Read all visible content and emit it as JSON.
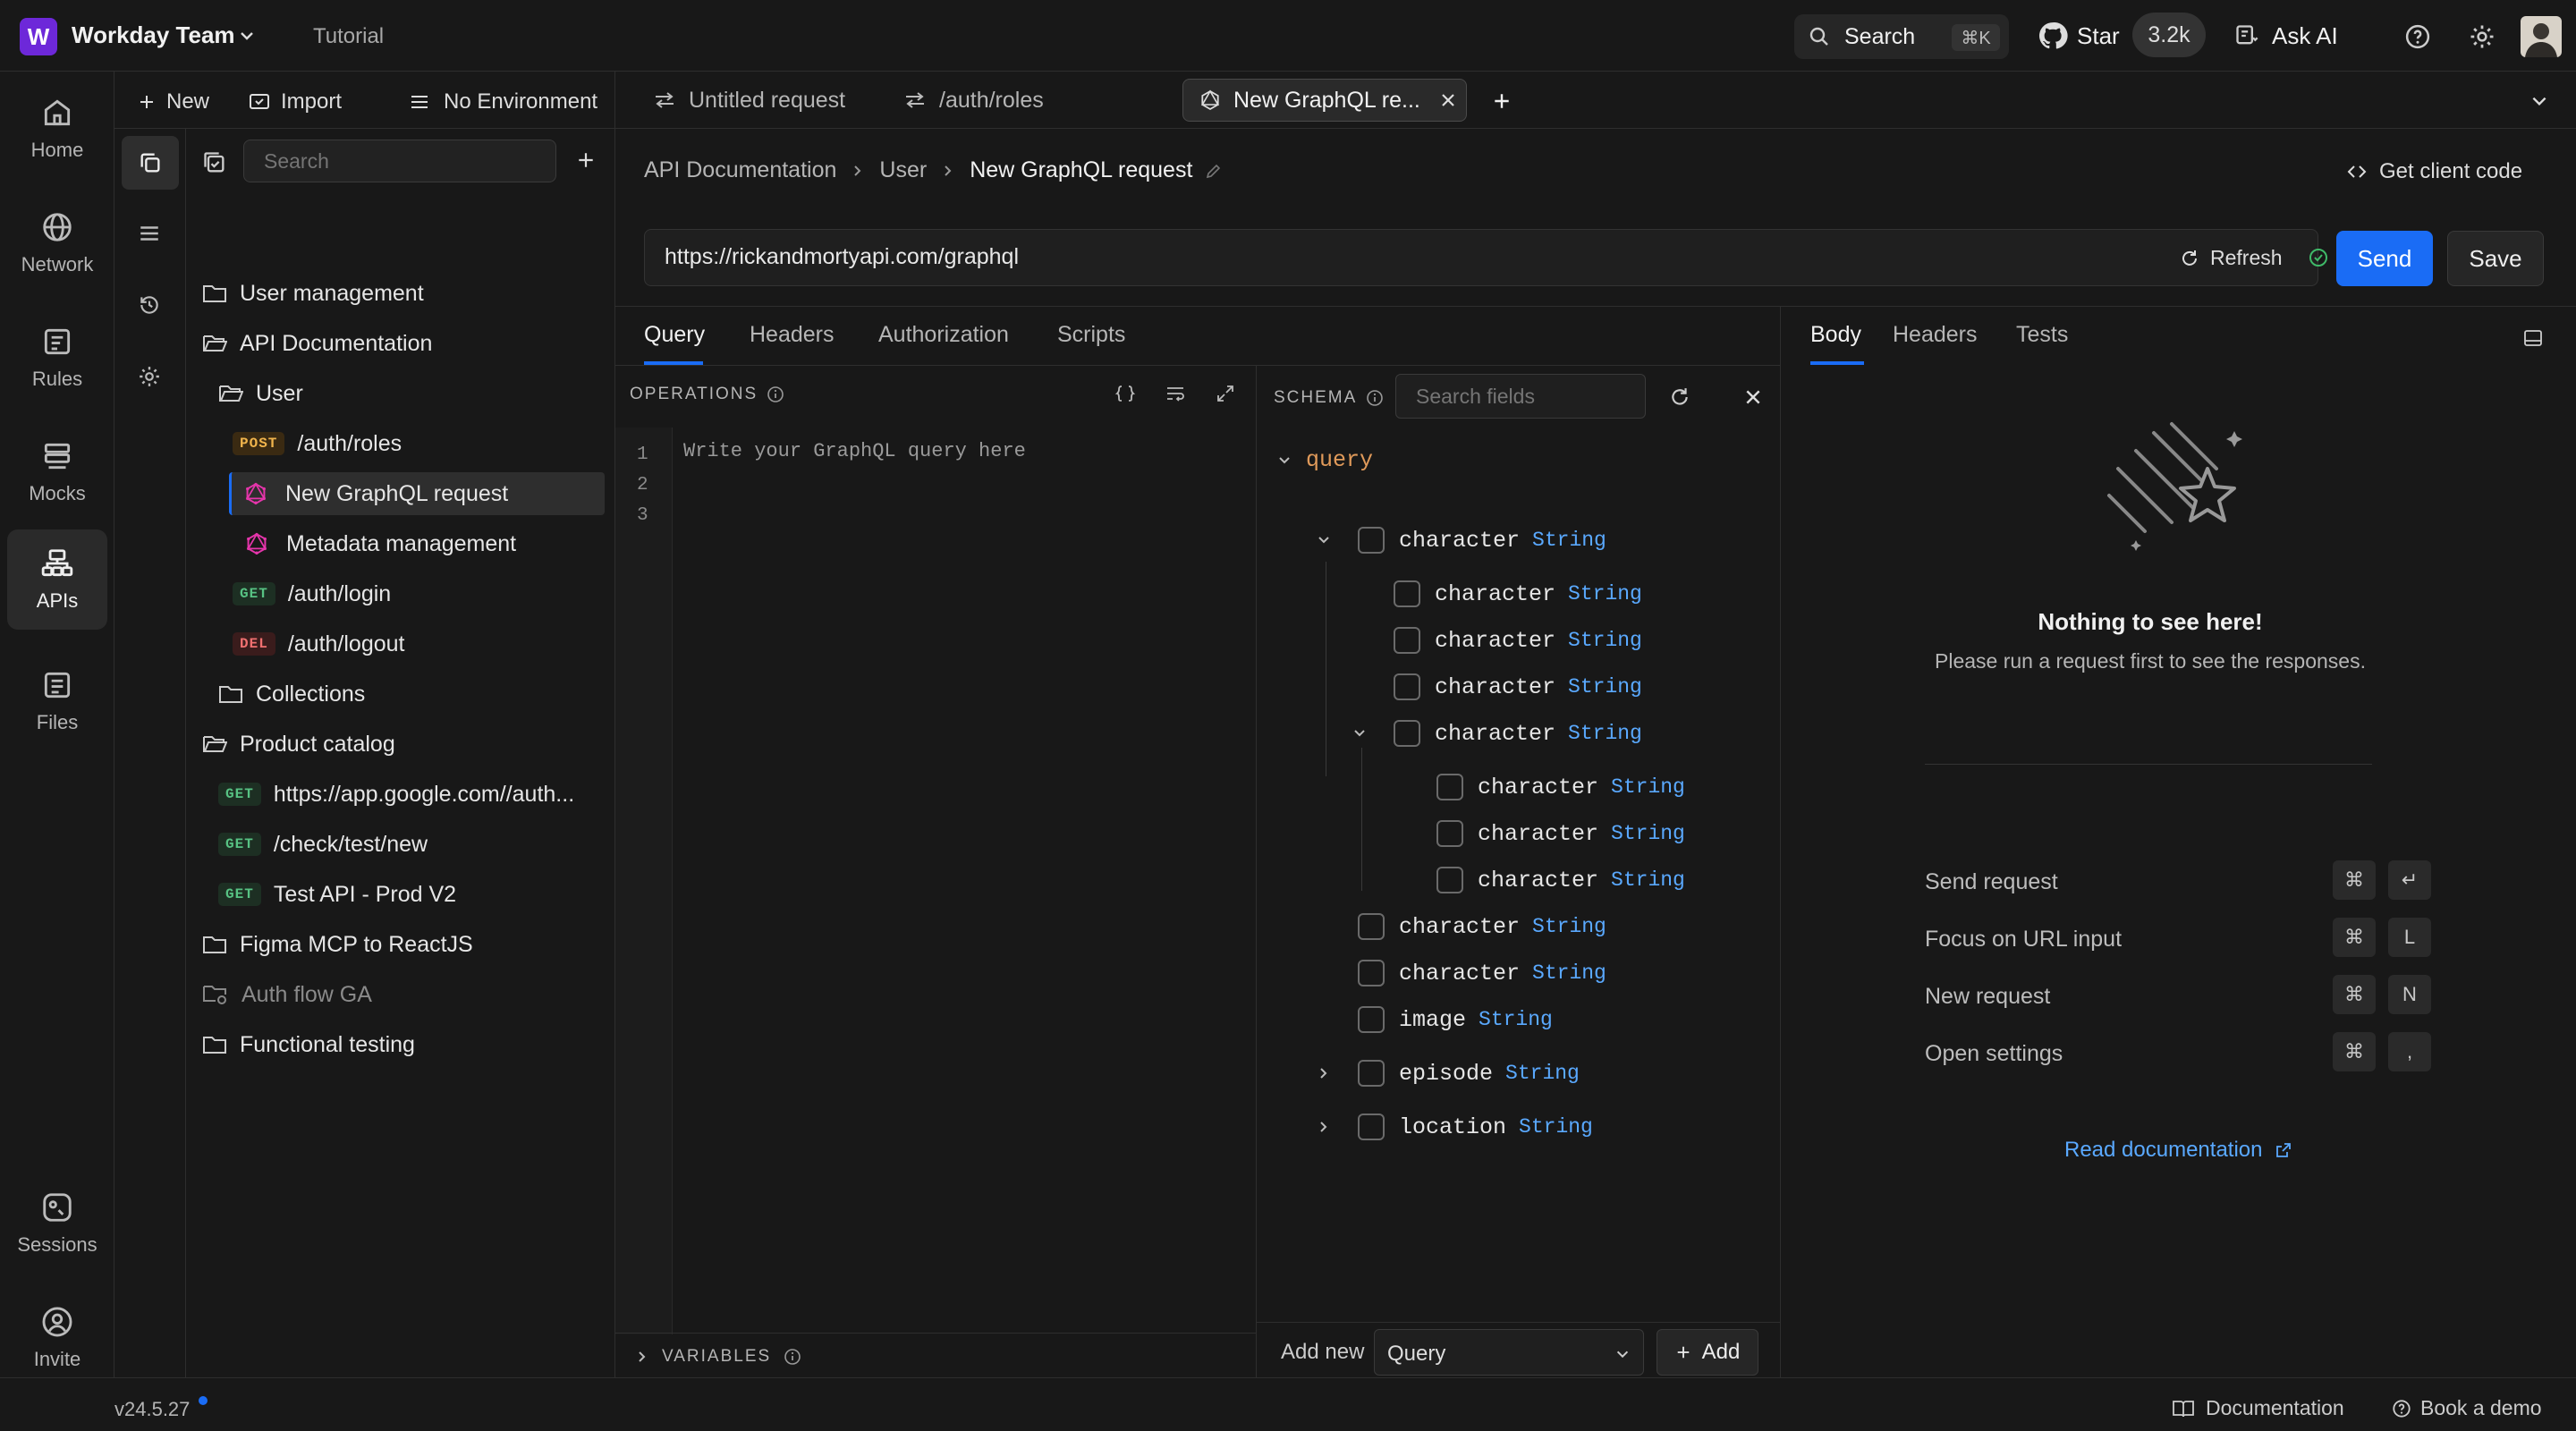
{
  "topbar": {
    "logo_letter": "W",
    "team": "Workday Team",
    "tutorial": "Tutorial",
    "search": "Search",
    "search_kbd": "⌘K",
    "star": "Star",
    "star_count": "3.2k",
    "ask_ai": "Ask AI"
  },
  "leftnav": {
    "items": [
      {
        "label": "Home",
        "icon": "home-icon"
      },
      {
        "label": "Network",
        "icon": "globe-icon"
      },
      {
        "label": "Rules",
        "icon": "rules-icon"
      },
      {
        "label": "Mocks",
        "icon": "mocks-icon"
      },
      {
        "label": "APIs",
        "icon": "apis-icon"
      },
      {
        "label": "Files",
        "icon": "files-icon"
      }
    ],
    "bottom": [
      {
        "label": "Sessions",
        "icon": "sessions-icon"
      },
      {
        "label": "Invite",
        "icon": "invite-icon"
      }
    ]
  },
  "sidebar": {
    "new": "New",
    "import": "Import",
    "environment": "No Environment",
    "search_placeholder": "Search",
    "tree": [
      {
        "label": "User management",
        "kind": "folder"
      },
      {
        "label": "API Documentation",
        "kind": "folder-open"
      },
      {
        "label": "User",
        "kind": "folder-open"
      },
      {
        "label": "/auth/roles",
        "kind": "request",
        "method": "POST"
      },
      {
        "label": "New GraphQL request",
        "kind": "graphql",
        "selected": true
      },
      {
        "label": "Metadata management",
        "kind": "graphql"
      },
      {
        "label": "/auth/login",
        "kind": "request",
        "method": "GET"
      },
      {
        "label": "/auth/logout",
        "kind": "request",
        "method": "DEL"
      },
      {
        "label": "Collections",
        "kind": "folder"
      },
      {
        "label": "Product catalog",
        "kind": "folder-open"
      },
      {
        "label": "https://app.google.com//auth...",
        "kind": "request",
        "method": "GET"
      },
      {
        "label": "/check/test/new",
        "kind": "request",
        "method": "GET"
      },
      {
        "label": "Test API - Prod V2",
        "kind": "request",
        "method": "GET"
      },
      {
        "label": "Figma MCP to ReactJS",
        "kind": "folder"
      },
      {
        "label": "Auth flow GA",
        "kind": "folder-dim"
      },
      {
        "label": "Functional testing",
        "kind": "folder"
      }
    ]
  },
  "tabs": [
    {
      "label": "Untitled request"
    },
    {
      "label": "/auth/roles"
    },
    {
      "label": "New GraphQL re...",
      "active": true
    }
  ],
  "breadcrumb": {
    "root": "API Documentation",
    "mid": "User",
    "current": "New GraphQL request",
    "client_code": "Get client code"
  },
  "url": {
    "value": "https://rickandmortyapi.com/graphql",
    "refresh": "Refresh",
    "send": "Send",
    "save": "Save"
  },
  "request_tabs": [
    "Query",
    "Headers",
    "Authorization",
    "Scripts"
  ],
  "operations": {
    "title": "OPERATIONS",
    "line_numbers": [
      "1",
      "2",
      "3"
    ],
    "placeholder": "Write your GraphQL query here",
    "variables": "VARIABLES"
  },
  "schema": {
    "title": "SCHEMA",
    "search_placeholder": "Search fields",
    "root": "query",
    "rows": [
      {
        "name": "character",
        "type": "String",
        "level": 1,
        "expander": "down"
      },
      {
        "name": "character",
        "type": "String",
        "level": 2
      },
      {
        "name": "character",
        "type": "String",
        "level": 2
      },
      {
        "name": "character",
        "type": "String",
        "level": 2
      },
      {
        "name": "character",
        "type": "String",
        "level": 2,
        "expander": "down"
      },
      {
        "name": "character",
        "type": "String",
        "level": 3
      },
      {
        "name": "character",
        "type": "String",
        "level": 3
      },
      {
        "name": "character",
        "type": "String",
        "level": 3
      },
      {
        "name": "character",
        "type": "String",
        "level": 1
      },
      {
        "name": "character",
        "type": "String",
        "level": 1
      },
      {
        "name": "image",
        "type": "String",
        "level": 1
      },
      {
        "name": "episode",
        "type": "String",
        "level": 1,
        "expander": "right"
      },
      {
        "name": "location",
        "type": "String",
        "level": 1,
        "expander": "right"
      }
    ],
    "add_new": "Add new",
    "add_type": "Query",
    "add": "Add"
  },
  "response": {
    "tabs": [
      "Body",
      "Headers",
      "Tests"
    ],
    "empty_title": "Nothing to see here!",
    "empty_sub": "Please run a request first to see the responses.",
    "shortcuts": [
      {
        "label": "Send request",
        "keys": [
          "⌘",
          "↵"
        ]
      },
      {
        "label": "Focus on URL input",
        "keys": [
          "⌘",
          "L"
        ]
      },
      {
        "label": "New request",
        "keys": [
          "⌘",
          "N"
        ]
      },
      {
        "label": "Open settings",
        "keys": [
          "⌘",
          ","
        ]
      }
    ],
    "docs_link": "Read documentation"
  },
  "status": {
    "version": "v24.5.27",
    "documentation": "Documentation",
    "demo": "Book a demo"
  },
  "colors": {
    "accent": "#1a6cf5",
    "brand": "#6d28d9",
    "graphql": "#e535ab"
  }
}
